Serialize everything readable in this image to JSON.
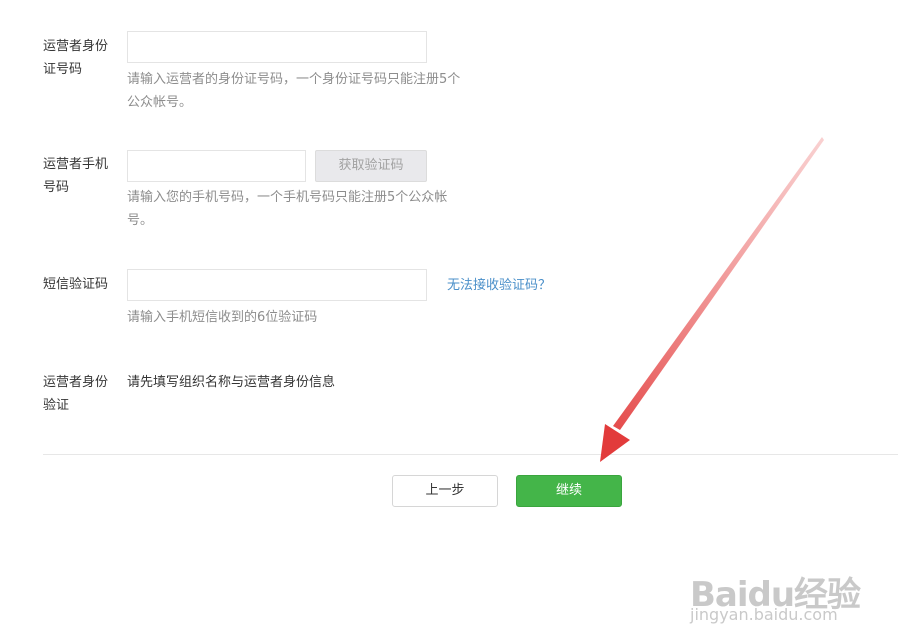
{
  "form": {
    "id_number": {
      "label_line1": "运营者身份",
      "label_line2": "证号码",
      "value": "",
      "hint_line1": "请输入运营者的身份证号码，一个身份证号码只能注册5个",
      "hint_line2": "公众帐号。"
    },
    "phone": {
      "label_line1": "运营者手机",
      "label_line2": "号码",
      "value": "",
      "get_code_button": "获取验证码",
      "hint_line1": "请输入您的手机号码，一个手机号码只能注册5个公众帐",
      "hint_line2": "号。"
    },
    "sms_code": {
      "label": "短信验证码",
      "value": "",
      "cannot_receive_link": "无法接收验证码？",
      "hint": "请输入手机短信收到的6位验证码"
    },
    "identity_verify": {
      "label_line1": "运营者身份",
      "label_line2": "验证",
      "text": "请先填写组织名称与运营者身份信息"
    }
  },
  "actions": {
    "prev_label": "上一步",
    "next_label": "继续"
  },
  "colors": {
    "primary_green": "#44b549",
    "link_blue": "#4a8fc9",
    "arrow_red": "#e23b3b"
  },
  "watermark": {
    "logo_text": "Baidu经验",
    "url_text": "jingyan.baidu.com"
  }
}
